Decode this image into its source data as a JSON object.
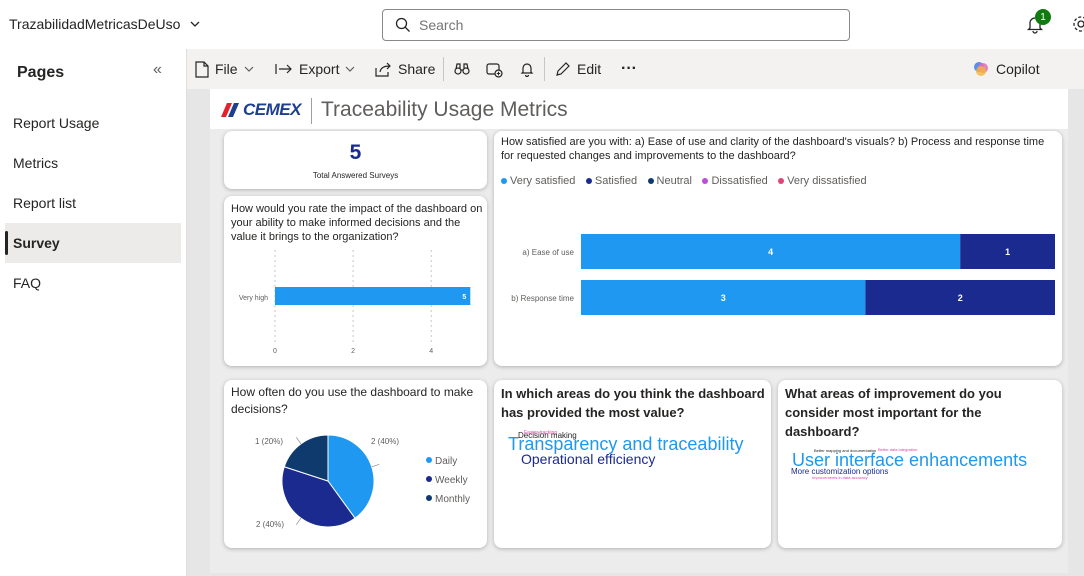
{
  "app": {
    "title": "TrazabilidadMetricasDeUso",
    "search_placeholder": "Search",
    "notification_count": "1"
  },
  "sidebar": {
    "title": "Pages",
    "items": [
      {
        "label": "Report Usage",
        "active": false
      },
      {
        "label": "Metrics",
        "active": false
      },
      {
        "label": "Report list",
        "active": false
      },
      {
        "label": "Survey",
        "active": true
      },
      {
        "label": "FAQ",
        "active": false
      }
    ]
  },
  "toolbar": {
    "file": "File",
    "export": "Export",
    "share": "Share",
    "edit": "Edit",
    "more": "···",
    "copilot": "Copilot"
  },
  "report": {
    "logo_text": "CEMEX",
    "title": "Traceability Usage Metrics"
  },
  "kpi": {
    "value": "5",
    "label": "Total Answered Surveys"
  },
  "impact_chart": {
    "title": "How would you rate the impact of the dashboard on your ability to make informed decisions and the value it brings to the organization?"
  },
  "satisfaction_chart": {
    "title": "How satisfied are you with: a) Ease of use and clarity of the dashboard's visuals? b) Process and response time for requested changes and improvements to the dashboard?"
  },
  "frequency_chart": {
    "title": "How often do you use the dashboard to make decisions?"
  },
  "value_areas": {
    "title": "In which areas do you think the dashboard has provided the most value?",
    "words": [
      {
        "text": "Transparency and traceability",
        "size": "large",
        "color": "#1e98f0"
      },
      {
        "text": "Operational efficiency",
        "size": "medium",
        "color": "#1b2a8f"
      },
      {
        "text": "Decision making",
        "size": "small",
        "color": "#252423"
      },
      {
        "text": "Faster tracking",
        "size": "tiny",
        "color": "#e044a7"
      }
    ]
  },
  "improvement_areas": {
    "title": "What areas of improvement do you consider most important for the dashboard?",
    "words": [
      {
        "text": "User interface enhancements",
        "size": "large",
        "color": "#1e98f0"
      },
      {
        "text": "More customization options",
        "size": "small",
        "color": "#1b2a8f"
      },
      {
        "text": "Better mapping and documentation",
        "size": "tiny",
        "color": "#252423"
      },
      {
        "text": "Better data integration",
        "size": "tiny",
        "color": "#e044a7"
      },
      {
        "text": "Improvements in data accuracy",
        "size": "tiny",
        "color": "#e044a7"
      }
    ]
  },
  "colors": {
    "very_satisfied": "#1e98f0",
    "satisfied": "#1b2a8f",
    "neutral": "#0f3a6e",
    "dissatisfied": "#b84fd6",
    "very_dissatisfied": "#e0447a",
    "daily": "#1e98f0",
    "weekly": "#1b2a8f",
    "monthly": "#0f3a6e",
    "kpi": "#1b2a8f"
  },
  "chart_data": [
    {
      "type": "bar",
      "orientation": "horizontal",
      "categories": [
        "Very high"
      ],
      "values": [
        5
      ],
      "data_labels": [
        "5"
      ],
      "xticks": [
        "0",
        "2",
        "4"
      ],
      "xlim": [
        0,
        5.3
      ],
      "grid": true
    },
    {
      "type": "bar",
      "orientation": "horizontal",
      "stacked": "100%",
      "categories": [
        "a) Ease of use",
        "b) Response time"
      ],
      "legend": [
        "Very satisfied",
        "Satisfied",
        "Neutral",
        "Dissatisfied",
        "Very dissatisfied"
      ],
      "legend_position": "top-left",
      "series": [
        {
          "name": "Very satisfied",
          "values": [
            4,
            3
          ]
        },
        {
          "name": "Satisfied",
          "values": [
            1,
            2
          ]
        },
        {
          "name": "Neutral",
          "values": [
            0,
            0
          ]
        },
        {
          "name": "Dissatisfied",
          "values": [
            0,
            0
          ]
        },
        {
          "name": "Very dissatisfied",
          "values": [
            0,
            0
          ]
        }
      ]
    },
    {
      "type": "pie",
      "donut": false,
      "legend": [
        "Daily",
        "Weekly",
        "Monthly"
      ],
      "legend_position": "right",
      "values": [
        2,
        2,
        1
      ],
      "slice_labels": [
        "2 (40%)",
        "2 (40%)",
        "1 (20%)"
      ]
    }
  ]
}
